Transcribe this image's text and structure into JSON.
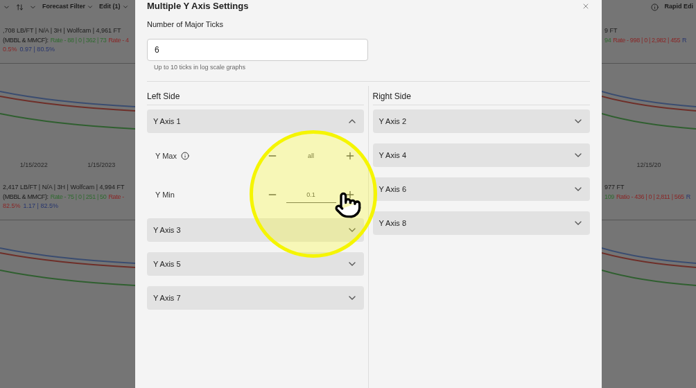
{
  "background": {
    "left": {
      "toolbar": [
        "Forecast Filter",
        "Edit (1)"
      ],
      "panels": [
        {
          "header": ",708 LB/FT | N/A | 3H | Wolfcam | 4,961 FT",
          "stats": [
            {
              "text": "(MBBL & MMCF):",
              "kind": "label"
            },
            {
              "text": "Rate - 88 | 0 | 362 | 73",
              "kind": "primary"
            },
            {
              "text": "Rate - 4",
              "kind": "secondary"
            }
          ],
          "ratios": [
            {
              "text": "0.5%",
              "kind": "secondary"
            },
            {
              "text": "0.97 | 80.5%",
              "kind": "tertiary"
            }
          ],
          "dates": [
            "1/15/2022",
            "1/15/2023"
          ]
        },
        {
          "header": "2,417 LB/FT | N/A | 3H | Wolfcam | 4,994 FT",
          "stats": [
            {
              "text": "(MBBL & MMCF):",
              "kind": "label"
            },
            {
              "text": "Rate - 75 | 0 | 251 | 50",
              "kind": "primary"
            },
            {
              "text": "Rate -",
              "kind": "secondary"
            }
          ],
          "ratios": [
            {
              "text": "82.5%",
              "kind": "secondary"
            },
            {
              "text": "1.17 | 82.5%",
              "kind": "tertiary"
            }
          ]
        }
      ]
    },
    "right": {
      "toolbar": [
        "Rapid Edi"
      ],
      "panels": [
        {
          "header": "9 FT",
          "stats": [
            {
              "text": "94",
              "kind": "primary"
            },
            {
              "text": "Rate - 998 | 0 | 2,982 | 455",
              "kind": "secondary"
            },
            {
              "text": "R",
              "kind": "tertiary"
            }
          ],
          "dates": [
            "12/15/20"
          ]
        },
        {
          "header": "977 FT",
          "stats": [
            {
              "text": "109",
              "kind": "primary"
            },
            {
              "text": "Ratio - 436 | 0 | 2,811 | 565",
              "kind": "secondary"
            },
            {
              "text": "R",
              "kind": "tertiary"
            }
          ]
        }
      ]
    }
  },
  "dialog": {
    "title": "Multiple Y Axis Settings",
    "ticks_label": "Number of Major Ticks",
    "ticks_value": "6",
    "ticks_helper": "Up to 10 ticks in log scale graphs",
    "left_side": {
      "heading": "Left Side",
      "axes": [
        {
          "label": "Y Axis 1",
          "expanded": true,
          "fields": [
            {
              "label": "Y Max",
              "info": true,
              "value": "all",
              "focused": false
            },
            {
              "label": "Y Min",
              "info": false,
              "value": "0.1",
              "focused": true
            }
          ]
        },
        {
          "label": "Y Axis 3",
          "expanded": false
        },
        {
          "label": "Y Axis 5",
          "expanded": false
        },
        {
          "label": "Y Axis 7",
          "expanded": false
        }
      ]
    },
    "right_side": {
      "heading": "Right Side",
      "axes": [
        {
          "label": "Y Axis 2",
          "expanded": false
        },
        {
          "label": "Y Axis 4",
          "expanded": false
        },
        {
          "label": "Y Axis 6",
          "expanded": false
        },
        {
          "label": "Y Axis 8",
          "expanded": false
        }
      ]
    }
  }
}
